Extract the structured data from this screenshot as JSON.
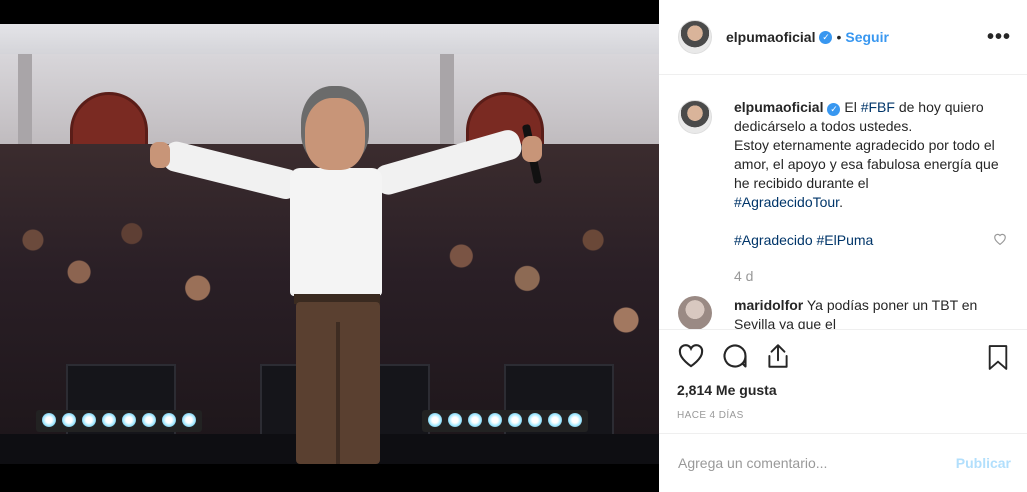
{
  "post": {
    "username": "elpumaoficial",
    "verified_badge": "✓",
    "separator": "•",
    "follow_label": "Seguir",
    "more_label": "•••"
  },
  "caption": {
    "username": "elpumaoficial",
    "text_part1": " El ",
    "hashtag1": "#FBF",
    "text_part2": " de hoy quiero dedicárselo a todos ustedes.",
    "line2": "Estoy eternamente agradecido por todo el amor, el apoyo y esa fabulosa energía que he recibido durante el",
    "hashtag2": "#AgradecidoTour",
    "text_part3": ".",
    "hashtag3": "#Agradecido",
    "hashtag4": "#ElPuma",
    "time_ago": "4 d"
  },
  "comment": {
    "username": "maridolfor",
    "text": " Ya podías poner un TBT en Sevilla ya que el"
  },
  "actions": {
    "likes": "2,814 Me gusta",
    "date": "HACE 4 DÍAS",
    "icons": [
      "heart-icon",
      "comment-icon",
      "share-icon",
      "bookmark-icon"
    ]
  },
  "add_comment": {
    "placeholder": "Agrega un comentario...",
    "publish_label": "Publicar"
  },
  "colors": {
    "link": "#3897f0",
    "hashtag": "#003569",
    "muted": "#999999",
    "publish_disabled": "#b2dffc"
  }
}
